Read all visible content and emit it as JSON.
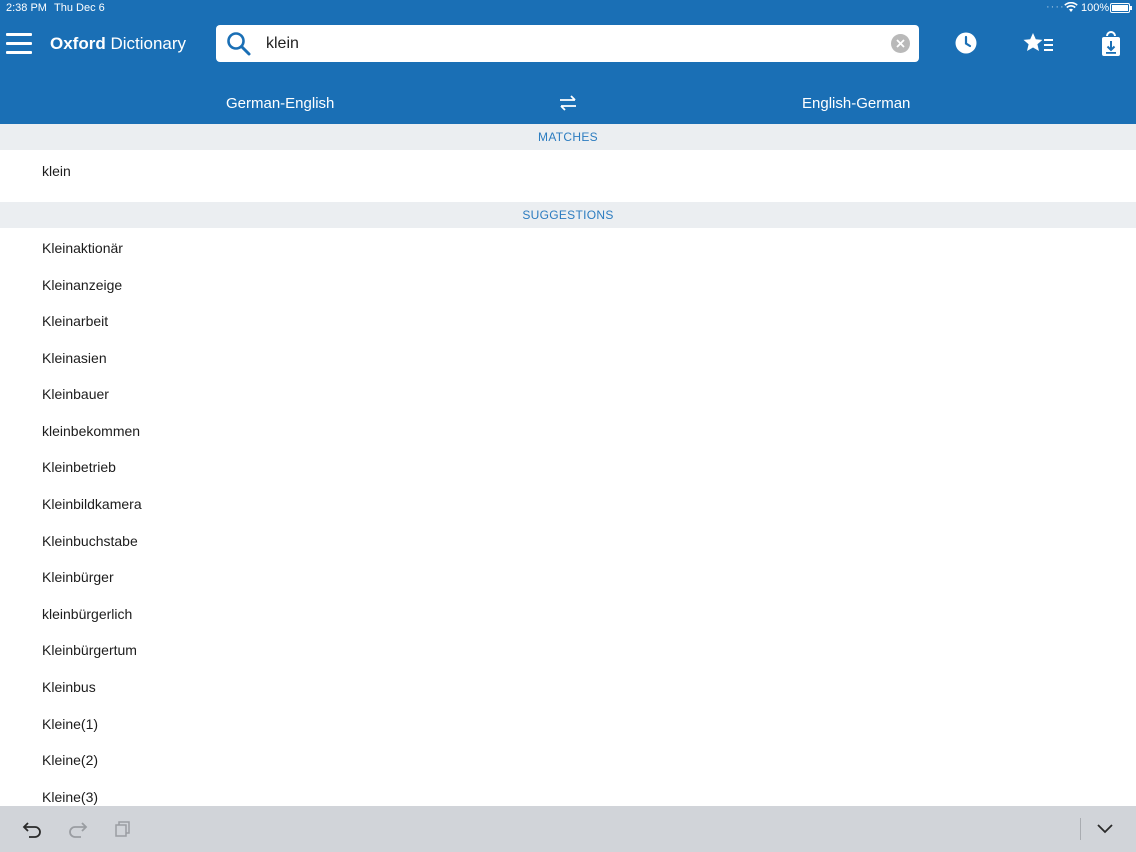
{
  "status_bar": {
    "time": "2:38 PM",
    "date": "Thu Dec 6",
    "battery": "100%"
  },
  "header": {
    "brand_bold": "Oxford",
    "brand_rest": " Dictionary",
    "background_color": "#1a6fb5",
    "icons": [
      "menu-icon",
      "search-icon",
      "clear-icon",
      "history-icon",
      "favorites-icon",
      "download-icon"
    ]
  },
  "search": {
    "value": "klein",
    "placeholder": ""
  },
  "languages": {
    "left": "German-English",
    "right": "English-German",
    "swap_icon": "swap-arrows-icon"
  },
  "matches": {
    "heading": "MATCHES",
    "items": [
      "klein"
    ]
  },
  "suggestions": {
    "heading": "SUGGESTIONS",
    "items": [
      "Kleinaktionär",
      "Kleinanzeige",
      "Kleinarbeit",
      "Kleinasien",
      "Kleinbauer",
      "kleinbekommen",
      "Kleinbetrieb",
      "Kleinbildkamera",
      "Kleinbuchstabe",
      "Kleinbürger",
      "kleinbürgerlich",
      "Kleinbürgertum",
      "Kleinbus",
      "Kleine(1)",
      "Kleine(2)",
      "Kleine(3)"
    ]
  },
  "bottom_bar": {
    "icons": [
      "undo-icon",
      "redo-icon",
      "paste-icon",
      "dismiss-keyboard-icon"
    ]
  }
}
